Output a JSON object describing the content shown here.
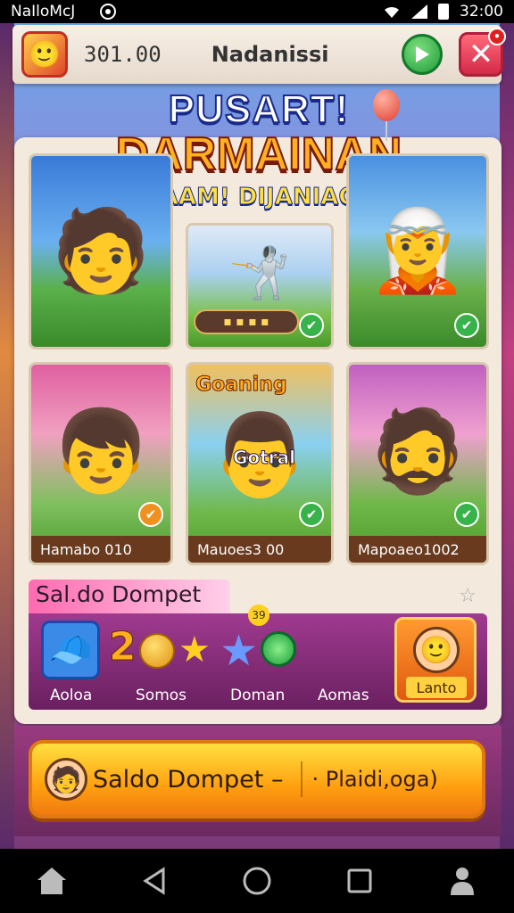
{
  "status_bar": {
    "carrier": "NaIloMcJ",
    "time": "32:00"
  },
  "header": {
    "coins": "301.00",
    "title": "Nadanissi"
  },
  "banner": {
    "line1": "PUSART!",
    "line2": "DARMAINAN",
    "line3": "GAAM! DIJANIAOR"
  },
  "cards": [
    {
      "caption": ""
    },
    {
      "caption": ""
    },
    {
      "caption": ""
    },
    {
      "caption": "Hamabo 010",
      "top_label": ""
    },
    {
      "caption": "Mauoes3 00",
      "top_label": "Goaning",
      "mid_label": "Gotral"
    },
    {
      "caption": "Mapoaeo1002"
    }
  ],
  "wallet": {
    "title": "Sal.do Dompet",
    "count": "2",
    "badge": "39",
    "labels": [
      "Aoloa",
      "Somos",
      "Doman",
      "Aomas"
    ],
    "action_label": "Lanto"
  },
  "bottom_button": {
    "label": "Saldo Dompet –",
    "right_label": "· Plaidi,oga)"
  },
  "colors": {
    "header_bg": "#f0e6da",
    "accent_orange": "#ffa010",
    "wallet_purple": "#8a2a80",
    "caption_brown": "#6a3a1e"
  }
}
